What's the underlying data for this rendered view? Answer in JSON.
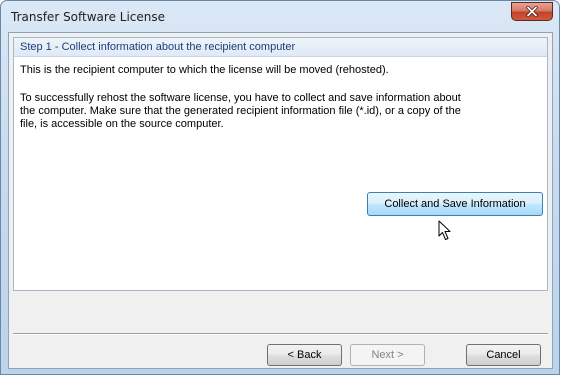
{
  "window": {
    "title": "Transfer Software License"
  },
  "step": {
    "header": "Step 1 - Collect information about the recipient computer",
    "intro": "This is the recipient computer to which the license will be moved (rehosted).",
    "instructions_line1": "To successfully rehost the software license, you have to collect and save information about",
    "instructions_line2": "the computer. Make sure that the generated recipient information file (*.id), or a copy of the",
    "instructions_line3": "file, is accessible on the source computer.",
    "collect_button": "Collect and Save Information"
  },
  "footer": {
    "back_label": "< Back",
    "next_label": "Next >",
    "cancel_label": "Cancel",
    "next_enabled": false
  },
  "icons": {
    "close": "close-icon",
    "cursor": "mouse-pointer-icon"
  },
  "colors": {
    "close_button": "#c7432b",
    "header_text": "#1c3d7a",
    "primary_button_border": "#3c7fb1"
  }
}
